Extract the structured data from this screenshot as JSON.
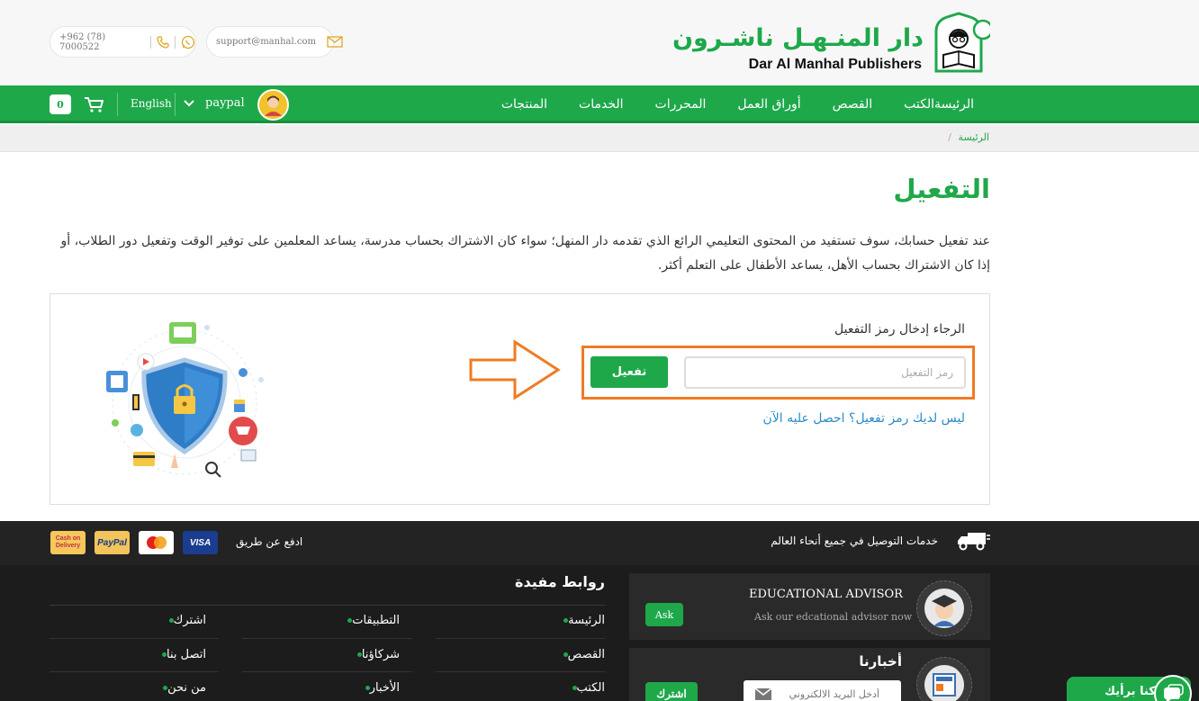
{
  "header": {
    "phone": "+962 (78) 7000522",
    "email": "support@manhal.com",
    "logo_ar": "دار المنـهـل ناشـرون",
    "logo_en": "Dar Al Manhal Publishers"
  },
  "nav": {
    "items": [
      "الرئيسة",
      "الكتب",
      "القصص",
      "أوراق العمل",
      "المحررات",
      "الخدمات",
      "المنتجات"
    ],
    "language": "English",
    "payment": "paypal",
    "cart_count": "0"
  },
  "breadcrumb": {
    "home": "الرئيسة",
    "separator": "/"
  },
  "main": {
    "title": "التفعيل",
    "intro": "عند تفعيل حسابك، سوف تستفيد من المحتوى التعليمي الرائع الذي تقدمه دار المنهل؛ سواء كان الاشتراك بحساب مدرسة، يساعد المعلمين على توفير الوقت وتفعيل دور الطلاب، أو إذا كان الاشتراك بحساب الأهل، يساعد الأطفال على التعلم أكثر.",
    "prompt": "الرجاء إدخال رمز التفعيل",
    "code_placeholder": "رمز التفعيل",
    "activate_label": "تفعيل",
    "no_code_link": "ليس لديك رمز تفعيل؟ احصل عليه الآن"
  },
  "pay_strip": {
    "delivery": "خدمات التوصيل في جميع أنحاء العالم",
    "pay_with": "ادفع عن طريق",
    "cards": [
      "Cash on Delivery",
      "PayPal",
      "MasterCard",
      "VISA"
    ]
  },
  "footer": {
    "links_title": "روابط مفيدة",
    "col1": [
      "الرئيسة",
      "القصص",
      "الكتب"
    ],
    "col2": [
      "التطبيقات",
      "شركاؤنا",
      "الأخبار"
    ],
    "col3": [
      "اشترك",
      "اتصل بنا",
      "من نحن"
    ],
    "advisor_title": "EDUCATIONAL ADVISOR",
    "advisor_sub": "Ask our edcational advisor now",
    "ask_label": "Ask",
    "news_title": "أخبارنا",
    "subscribe_label": "اشترك",
    "email_placeholder": "أدخل البريد الالكتروني",
    "chat_label": "شاركنا برأيك"
  },
  "colors": {
    "brand_green": "#1ea84a",
    "highlight_orange": "#f07b23",
    "link_blue": "#2a8bc9",
    "footer_dark": "#1c1c1c"
  }
}
